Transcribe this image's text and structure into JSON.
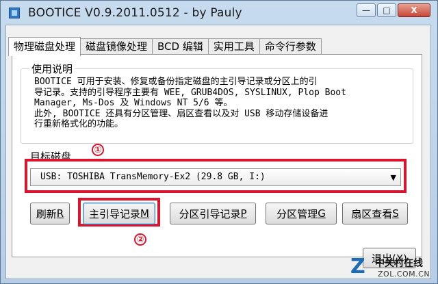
{
  "window": {
    "title": "BOOTICE V0.9.2011.0512 - by Pauly",
    "controls": {
      "minimize": "—",
      "maximize": "□",
      "close": "X"
    }
  },
  "tabs": [
    {
      "label": "物理磁盘处理",
      "active": true
    },
    {
      "label": "磁盘镜像处理",
      "active": false
    },
    {
      "label": "BCD 编辑",
      "active": false
    },
    {
      "label": "实用工具",
      "active": false
    },
    {
      "label": "命令行参数",
      "active": false
    }
  ],
  "usage": {
    "legend": "使用说明",
    "text": "BOOTICE 可用于安装、修复或备份指定磁盘的主引导记录或分区上的引\n导记录。支持的引导程序主要有 WEE, GRUB4DOS, SYSLINUX, Plop Boot\nManager, Ms-Dos 及 Windows NT 5/6 等。\n此外, BOOTICE 还具有分区管理、扇区查看以及对 USB 移动存储设备进\n行重新格式化的功能。"
  },
  "target_disk": {
    "label": "目标磁盘",
    "selected": "USB: TOSHIBA TransMemory-Ex2 (29.8 GB, I:)"
  },
  "annotations": {
    "one": "①",
    "two": "②"
  },
  "buttons": {
    "refresh": {
      "text": "刷新",
      "key": "R"
    },
    "main_mbr": {
      "text": "主引导记录",
      "key": "M"
    },
    "partition_boot": {
      "text": "分区引导记录",
      "key": "P"
    },
    "partition_manage": {
      "text": "分区管理",
      "key": "G"
    },
    "sector_view": {
      "text": "扇区查看",
      "key": "S"
    },
    "exit": "退出(X)"
  },
  "watermark": {
    "logo": "Z",
    "line1": "中关村在线",
    "line2": "ZOL.COM.CN"
  },
  "colors": {
    "annotation_red": "#d9162e",
    "title_blue": "#c7dbef"
  }
}
